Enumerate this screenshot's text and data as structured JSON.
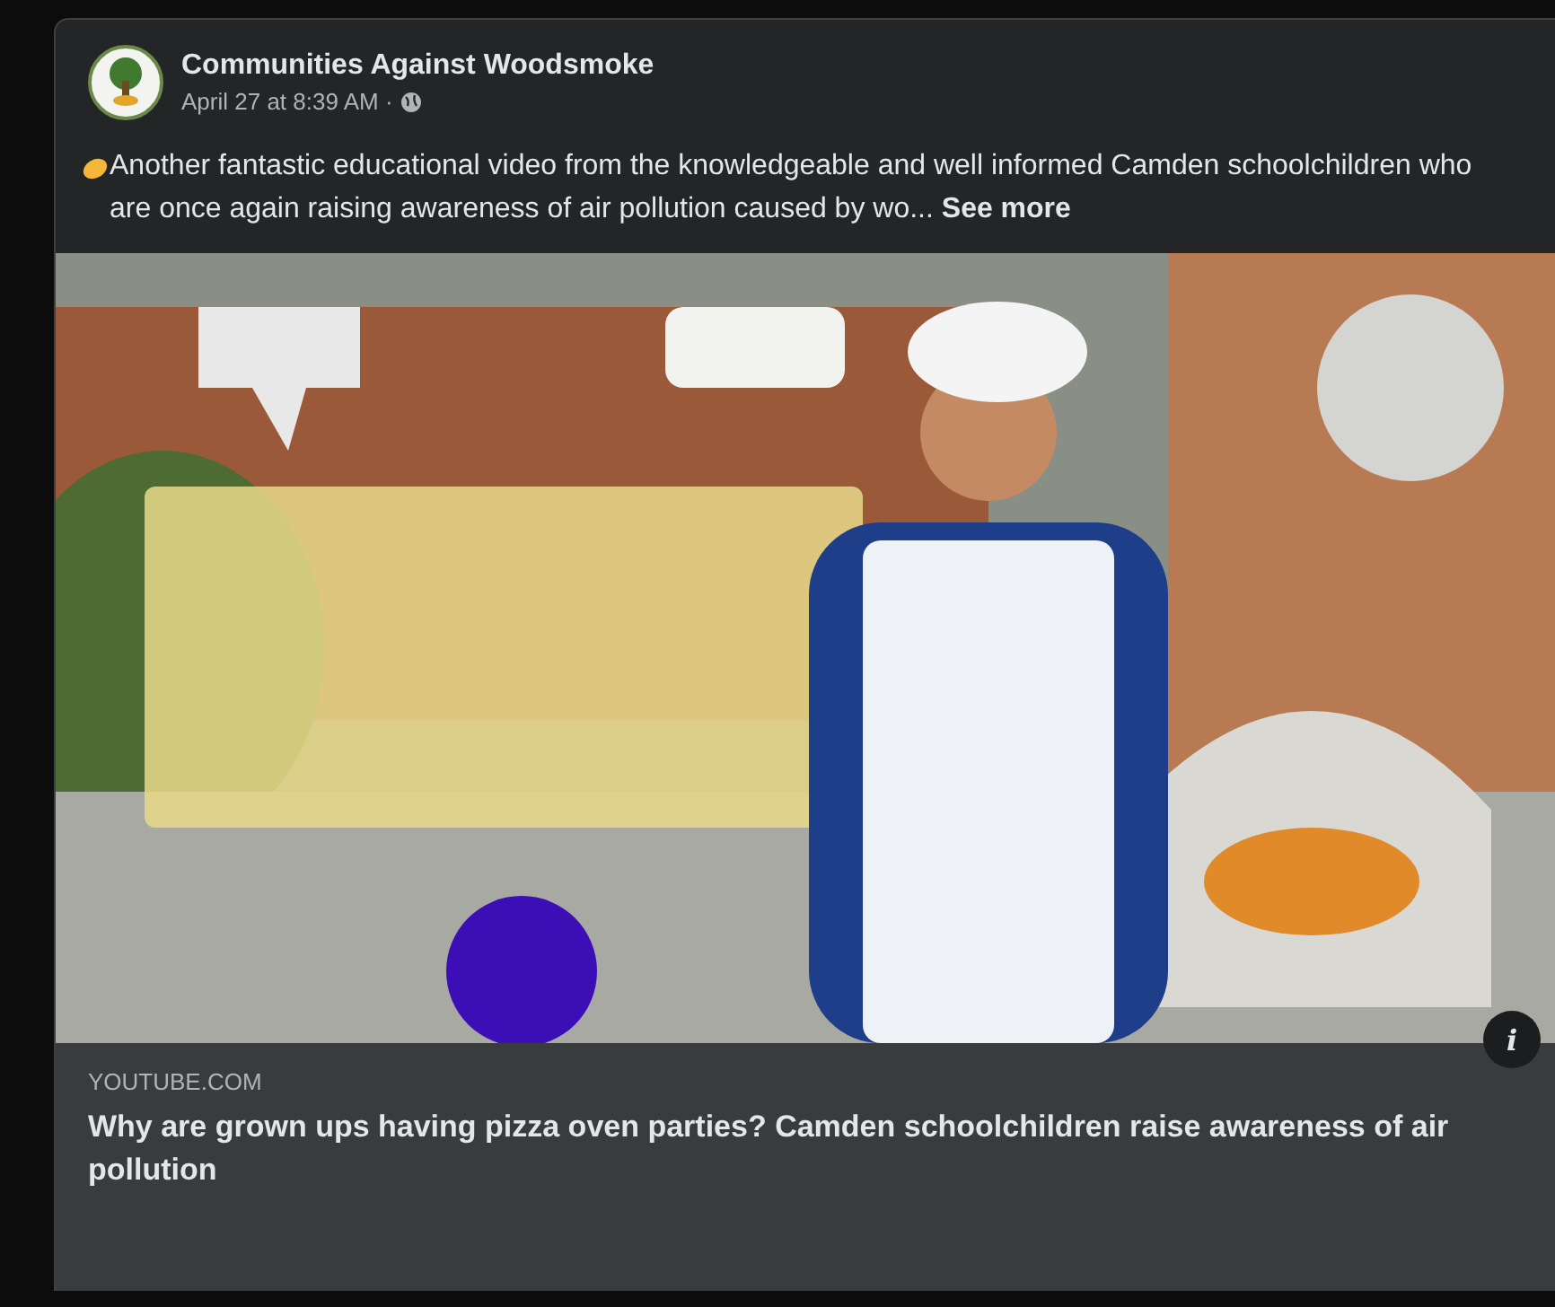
{
  "post": {
    "author": "Communities Against Woodsmoke",
    "timestamp": "April 27 at 8:39 AM ·",
    "text": "Another fantastic educational video from the knowledgeable and well informed Camden schoolchildren who are once again  raising awareness of air pollution caused by  wo...",
    "see_more": "See more"
  },
  "link_preview": {
    "info": "i",
    "domain": "YOUTUBE.COM",
    "title": "Why are grown ups having pizza oven parties? Camden schoolchildren raise awareness of air pollution"
  }
}
